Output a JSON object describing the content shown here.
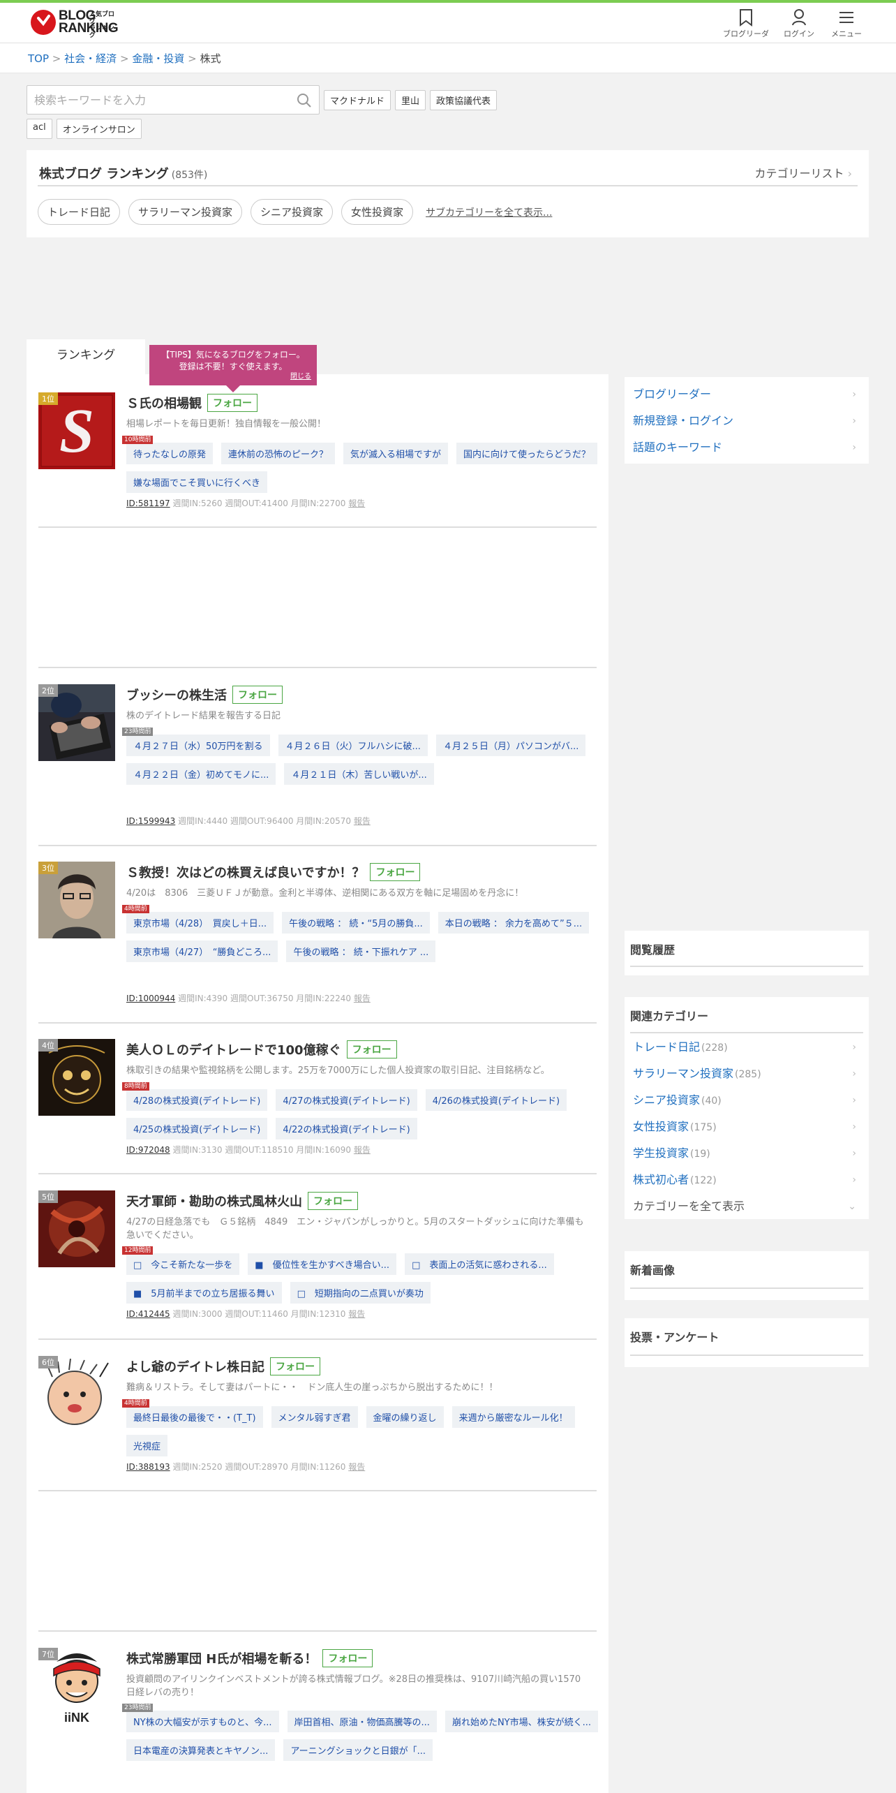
{
  "header": {
    "logo_line1": "BLOG",
    "logo_line2": "RANKING",
    "logo_sub1": "人気ブログ",
    "logo_sub2": "ランキング",
    "blog_reader": "ブログリーダー",
    "login": "ログイン",
    "menu": "メニュー"
  },
  "breadcrumb": [
    "TOP",
    "社会・経済",
    "金融・投資",
    "株式"
  ],
  "breadcrumb_sep": ">",
  "search": {
    "placeholder": "検索キーワードを入力"
  },
  "keywords": [
    "マクドナルド",
    "里山",
    "政策協議代表",
    "acl",
    "オンラインサロン"
  ],
  "ranking_header": {
    "title": "株式ブログ ランキング",
    "count": "(853件)",
    "category_list": "カテゴリーリスト",
    "subcategories": [
      "トレード日記",
      "サラリーマン投資家",
      "シニア投資家",
      "女性投資家"
    ],
    "more": "サブカテゴリーを全て表示..."
  },
  "tab": "ランキング",
  "tips": {
    "line1": "【TIPS】気になるブログをフォロー。",
    "line2": "登録は不要！すぐ使えます。",
    "close": "閉じる"
  },
  "follow_label": "フォロー",
  "entries": [
    {
      "rank": "1位",
      "title": "Ｓ氏の相場観",
      "desc": "相場レポートを毎日更新！独自情報を一般公開！",
      "time": "10時間前",
      "articles": [
        "待ったなしの原発",
        "連休前の恐怖のピーク？",
        "気が滅入る相場ですが",
        "国内に向けて使ったらどうだ？",
        "嫌な場面でこそ買いに行くべき"
      ],
      "id": "ID:581197",
      "stats": "週間IN:5260 週間OUT:41400 月間IN:22700",
      "report": "報告"
    },
    {
      "rank": "2位",
      "title": "ブッシーの株生活",
      "desc": "株のデイトレード結果を報告する日記",
      "time": "23時間前",
      "articles": [
        "４月２７日（水）50万円を割る",
        "４月２６日（火）フルハシに破...",
        "４月２５日（月）パソコンがバ...",
        "４月２２日（金）初めてモノに...",
        "４月２１日（木）苦しい戦いが..."
      ],
      "id": "ID:1599943",
      "stats": "週間IN:4440 週間OUT:96400 月間IN:20570",
      "report": "報告"
    },
    {
      "rank": "3位",
      "title": "Ｓ教授！次はどの株買えば良いですか！？",
      "desc": "4/20は　8306　三菱ＵＦＪが動意。金利と半導体、逆相関にある双方を軸に足場固めを丹念に！",
      "time": "4時間前",
      "articles": [
        "東京市場（4/28）　買戻し＋日...",
        "午後の戦略 ： 続・“5月の勝負...",
        "本日の戦略 ： 余力を高めて”５...",
        "東京市場（4/27）　“勝負どころ...",
        "午後の戦略 ： 続・下振れケア ..."
      ],
      "id": "ID:1000944",
      "stats": "週間IN:4390 週間OUT:36750 月間IN:22240",
      "report": "報告"
    },
    {
      "rank": "4位",
      "title": "美人ＯＬのデイトレードで100億稼ぐ",
      "desc": "株取引きの結果や監視銘柄を公開します。25万を7000万にした個人投資家の取引日記、注目銘柄など。",
      "time": "8時間前",
      "articles": [
        "4/28の株式投資(デイトレード)",
        "4/27の株式投資(デイトレード)",
        "4/26の株式投資(デイトレード)",
        "4/25の株式投資(デイトレード)",
        "4/22の株式投資(デイトレード)"
      ],
      "id": "ID:972048",
      "stats": "週間IN:3130 週間OUT:118510 月間IN:16090",
      "report": "報告"
    },
    {
      "rank": "5位",
      "title": "天才軍師・勘助の株式風林火山",
      "desc": "4/27の日経急落でも　Ｇ５銘柄　4849　エン・ジャパンがしっかりと。5月のスタートダッシュに向けた準備も急いでください。",
      "time": "12時間前",
      "articles": [
        "□　今こそ新たな一歩を",
        "■　優位性を生かすべき場合い...",
        "□　表面上の活気に惑わされる...",
        "■　5月前半までの立ち居振る舞い",
        "□　短期指向の二点買いが奏功"
      ],
      "id": "ID:412445",
      "stats": "週間IN:3000 週間OUT:11460 月間IN:12310",
      "report": "報告"
    },
    {
      "rank": "6位",
      "title": "よし爺のデイトレ株日記",
      "desc": "難病＆リストラ。そして妻はパートに・・　ドン底人生の崖っぷちから脱出するために！！",
      "time": "4時間前",
      "articles": [
        "最終日最後の最後で・・(T_T)",
        "メンタル弱すぎ君",
        "金曜の繰り返し",
        "来週から厳密なルール化！",
        "光視症"
      ],
      "id": "ID:388193",
      "stats": "週間IN:2520 週間OUT:28970 月間IN:11260",
      "report": "報告"
    },
    {
      "rank": "7位",
      "title": "株式常勝軍団 H氏が相場を斬る！",
      "desc": "投資顧問のアイリンクインベストメントが誇る株式情報ブログ。※28日の推奨株は、9107川崎汽船の買い1570日経レバの売り！",
      "time": "23時間前",
      "articles": [
        "NY株の大幅安が示すものと、今...",
        "岸田首相、原油・物価高騰等の...",
        "崩れ始めたNY市場、株安が続く...",
        "日本電産の決算発表とキヤノン...",
        "アーニングショックと日銀が「..."
      ],
      "id": "",
      "stats": "",
      "report": ""
    }
  ],
  "sidebar": {
    "links": [
      "ブログリーダー",
      "新規登録・ログイン",
      "話題のキーワード"
    ],
    "history_title": "閲覧履歴",
    "related_title": "関連カテゴリー",
    "related": [
      {
        "name": "トレード日記",
        "count": "(228)"
      },
      {
        "name": "サラリーマン投資家",
        "count": "(285)"
      },
      {
        "name": "シニア投資家",
        "count": "(40)"
      },
      {
        "name": "女性投資家",
        "count": "(175)"
      },
      {
        "name": "学生投資家",
        "count": "(19)"
      },
      {
        "name": "株式初心者",
        "count": "(122)"
      }
    ],
    "show_all": "カテゴリーを全て表示",
    "new_images_title": "新着画像",
    "poll_title": "投票・アンケート"
  },
  "colors": {
    "accent_green": "#7ccc52",
    "link_blue": "#1f6fbf",
    "tips_pink": "#c0457e",
    "follow_green": "#4aa642",
    "logo_red": "#d8161c"
  }
}
